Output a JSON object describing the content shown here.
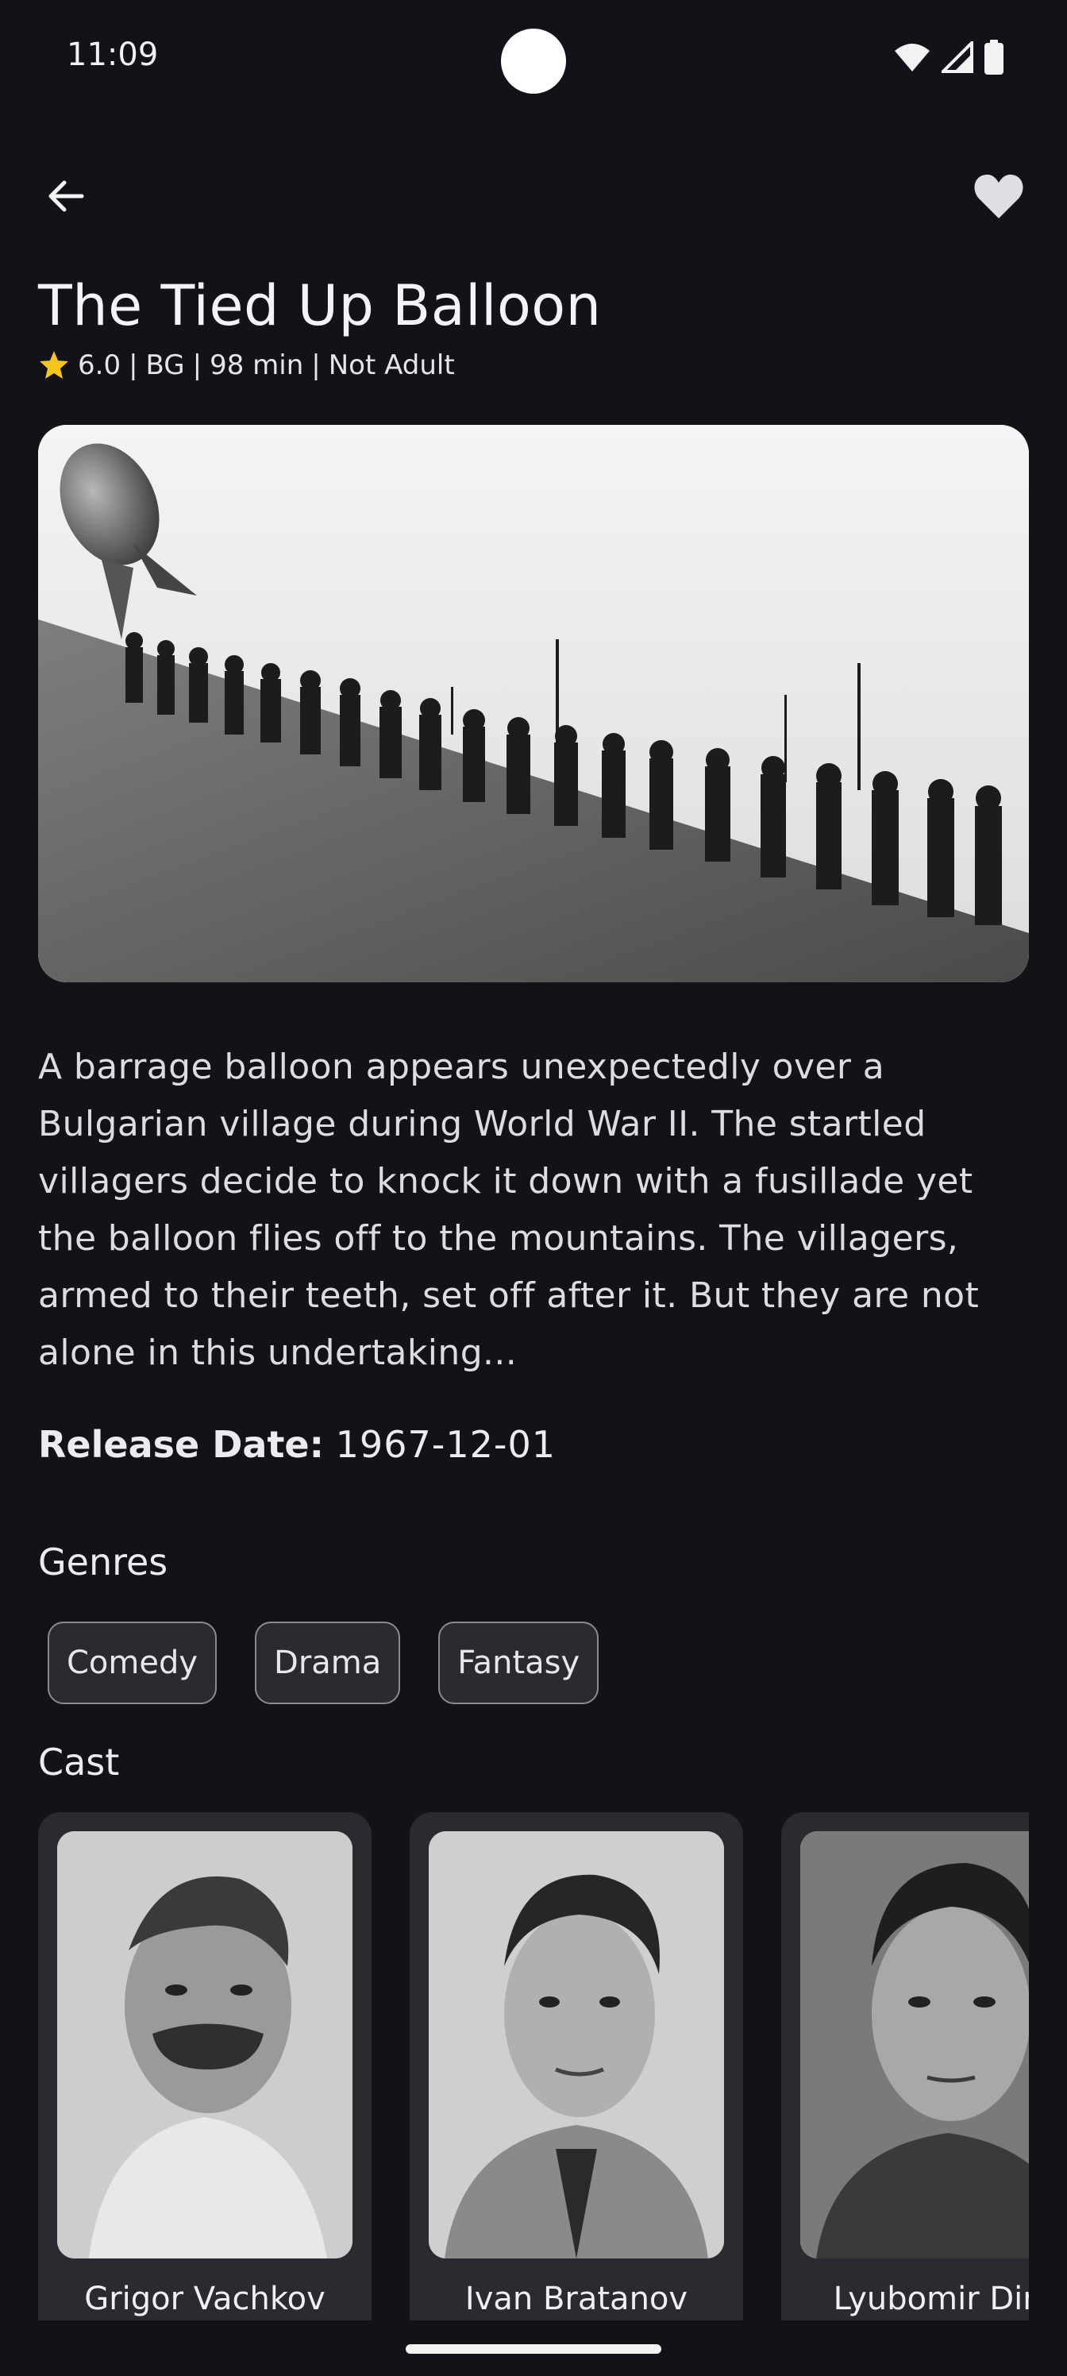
{
  "status": {
    "time": "11:09"
  },
  "movie": {
    "title": "The Tied Up Balloon",
    "rating": "6.0",
    "country": "BG",
    "runtime": "98 min",
    "adult": "Not Adult",
    "overview": "A barrage balloon appears unexpectedly over a Bulgarian village during World War II. The startled villagers decide to knock it down with a fusillade yet the balloon flies off to the mountains. The villagers, armed to their teeth, set off after it. But they are not alone in this undertaking...",
    "release_label": "Release Date:",
    "release_date": "1967-12-01"
  },
  "genres": {
    "title": "Genres",
    "items": [
      "Comedy",
      "Drama",
      "Fantasy"
    ]
  },
  "cast": {
    "title": "Cast",
    "items": [
      {
        "name": "Grigor Vachkov"
      },
      {
        "name": "Ivan Bratanov"
      },
      {
        "name": "Lyubomir Dimi"
      }
    ]
  },
  "icons": {
    "back": "arrow-left-icon",
    "favorite": "heart-icon",
    "rating": "star-icon"
  },
  "colors": {
    "background": "#121218",
    "star": "#f5c518",
    "chip_bg": "#2a2a30",
    "card_bg": "#2a2a31"
  }
}
